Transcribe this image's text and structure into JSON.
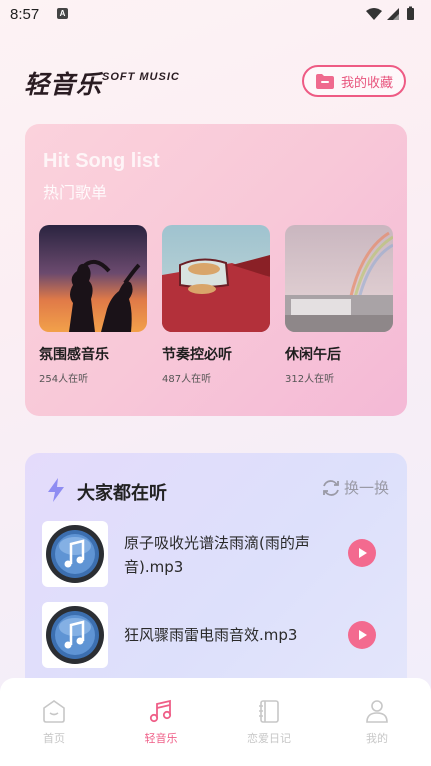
{
  "status_bar": {
    "time": "8:57",
    "notification_letter": "A"
  },
  "header": {
    "logo_text": "轻音乐",
    "logo_subtitle": "SOFT MUSIC",
    "favorites_label": "我的收藏"
  },
  "hot_songs": {
    "title_en": "Hit Song list",
    "title_cn": "热门歌单",
    "items": [
      {
        "name": "氛围感音乐",
        "listeners": "254人在听"
      },
      {
        "name": "节奏控必听",
        "listeners": "487人在听"
      },
      {
        "name": "休闲午后",
        "listeners": "312人在听"
      }
    ]
  },
  "now_listening": {
    "title": "大家都在听",
    "refresh_label": "换一换",
    "tracks": [
      {
        "title": "原子吸收光谱法雨滴(雨的声音).mp3"
      },
      {
        "title": "狂风骤雨雷电雨音效.mp3"
      }
    ]
  },
  "tab_bar": {
    "tabs": [
      {
        "label": "首页",
        "active": false
      },
      {
        "label": "轻音乐",
        "active": true
      },
      {
        "label": "恋爱日记",
        "active": false
      },
      {
        "label": "我的",
        "active": false
      }
    ]
  },
  "colors": {
    "accent": "#ef5f88",
    "inactive": "#c7c7c7"
  }
}
